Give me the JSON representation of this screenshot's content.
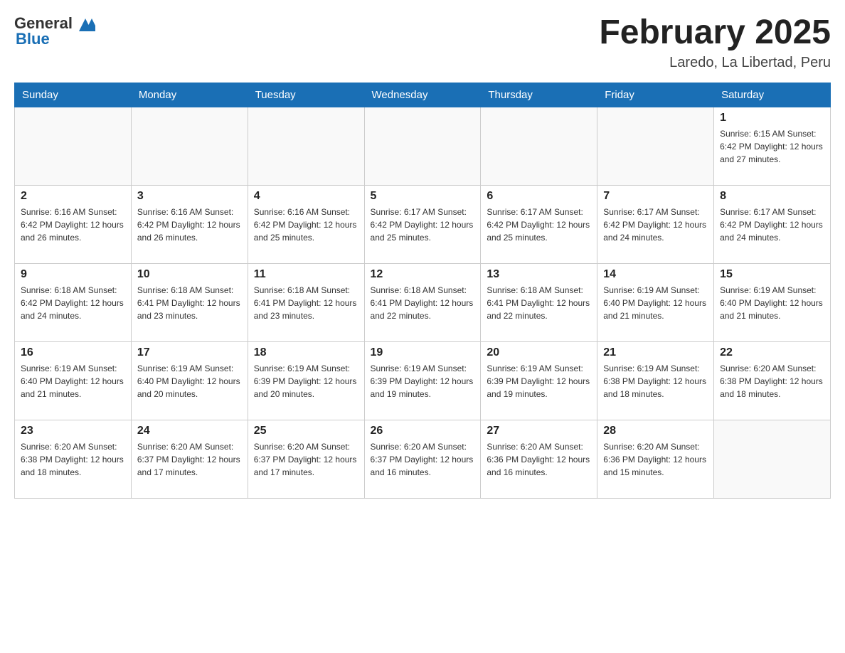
{
  "header": {
    "logo_general": "General",
    "logo_blue": "Blue",
    "month_title": "February 2025",
    "location": "Laredo, La Libertad, Peru"
  },
  "days_of_week": [
    "Sunday",
    "Monday",
    "Tuesday",
    "Wednesday",
    "Thursday",
    "Friday",
    "Saturday"
  ],
  "weeks": [
    [
      {
        "day": "",
        "info": ""
      },
      {
        "day": "",
        "info": ""
      },
      {
        "day": "",
        "info": ""
      },
      {
        "day": "",
        "info": ""
      },
      {
        "day": "",
        "info": ""
      },
      {
        "day": "",
        "info": ""
      },
      {
        "day": "1",
        "info": "Sunrise: 6:15 AM\nSunset: 6:42 PM\nDaylight: 12 hours and 27 minutes."
      }
    ],
    [
      {
        "day": "2",
        "info": "Sunrise: 6:16 AM\nSunset: 6:42 PM\nDaylight: 12 hours and 26 minutes."
      },
      {
        "day": "3",
        "info": "Sunrise: 6:16 AM\nSunset: 6:42 PM\nDaylight: 12 hours and 26 minutes."
      },
      {
        "day": "4",
        "info": "Sunrise: 6:16 AM\nSunset: 6:42 PM\nDaylight: 12 hours and 25 minutes."
      },
      {
        "day": "5",
        "info": "Sunrise: 6:17 AM\nSunset: 6:42 PM\nDaylight: 12 hours and 25 minutes."
      },
      {
        "day": "6",
        "info": "Sunrise: 6:17 AM\nSunset: 6:42 PM\nDaylight: 12 hours and 25 minutes."
      },
      {
        "day": "7",
        "info": "Sunrise: 6:17 AM\nSunset: 6:42 PM\nDaylight: 12 hours and 24 minutes."
      },
      {
        "day": "8",
        "info": "Sunrise: 6:17 AM\nSunset: 6:42 PM\nDaylight: 12 hours and 24 minutes."
      }
    ],
    [
      {
        "day": "9",
        "info": "Sunrise: 6:18 AM\nSunset: 6:42 PM\nDaylight: 12 hours and 24 minutes."
      },
      {
        "day": "10",
        "info": "Sunrise: 6:18 AM\nSunset: 6:41 PM\nDaylight: 12 hours and 23 minutes."
      },
      {
        "day": "11",
        "info": "Sunrise: 6:18 AM\nSunset: 6:41 PM\nDaylight: 12 hours and 23 minutes."
      },
      {
        "day": "12",
        "info": "Sunrise: 6:18 AM\nSunset: 6:41 PM\nDaylight: 12 hours and 22 minutes."
      },
      {
        "day": "13",
        "info": "Sunrise: 6:18 AM\nSunset: 6:41 PM\nDaylight: 12 hours and 22 minutes."
      },
      {
        "day": "14",
        "info": "Sunrise: 6:19 AM\nSunset: 6:40 PM\nDaylight: 12 hours and 21 minutes."
      },
      {
        "day": "15",
        "info": "Sunrise: 6:19 AM\nSunset: 6:40 PM\nDaylight: 12 hours and 21 minutes."
      }
    ],
    [
      {
        "day": "16",
        "info": "Sunrise: 6:19 AM\nSunset: 6:40 PM\nDaylight: 12 hours and 21 minutes."
      },
      {
        "day": "17",
        "info": "Sunrise: 6:19 AM\nSunset: 6:40 PM\nDaylight: 12 hours and 20 minutes."
      },
      {
        "day": "18",
        "info": "Sunrise: 6:19 AM\nSunset: 6:39 PM\nDaylight: 12 hours and 20 minutes."
      },
      {
        "day": "19",
        "info": "Sunrise: 6:19 AM\nSunset: 6:39 PM\nDaylight: 12 hours and 19 minutes."
      },
      {
        "day": "20",
        "info": "Sunrise: 6:19 AM\nSunset: 6:39 PM\nDaylight: 12 hours and 19 minutes."
      },
      {
        "day": "21",
        "info": "Sunrise: 6:19 AM\nSunset: 6:38 PM\nDaylight: 12 hours and 18 minutes."
      },
      {
        "day": "22",
        "info": "Sunrise: 6:20 AM\nSunset: 6:38 PM\nDaylight: 12 hours and 18 minutes."
      }
    ],
    [
      {
        "day": "23",
        "info": "Sunrise: 6:20 AM\nSunset: 6:38 PM\nDaylight: 12 hours and 18 minutes."
      },
      {
        "day": "24",
        "info": "Sunrise: 6:20 AM\nSunset: 6:37 PM\nDaylight: 12 hours and 17 minutes."
      },
      {
        "day": "25",
        "info": "Sunrise: 6:20 AM\nSunset: 6:37 PM\nDaylight: 12 hours and 17 minutes."
      },
      {
        "day": "26",
        "info": "Sunrise: 6:20 AM\nSunset: 6:37 PM\nDaylight: 12 hours and 16 minutes."
      },
      {
        "day": "27",
        "info": "Sunrise: 6:20 AM\nSunset: 6:36 PM\nDaylight: 12 hours and 16 minutes."
      },
      {
        "day": "28",
        "info": "Sunrise: 6:20 AM\nSunset: 6:36 PM\nDaylight: 12 hours and 15 minutes."
      },
      {
        "day": "",
        "info": ""
      }
    ]
  ]
}
